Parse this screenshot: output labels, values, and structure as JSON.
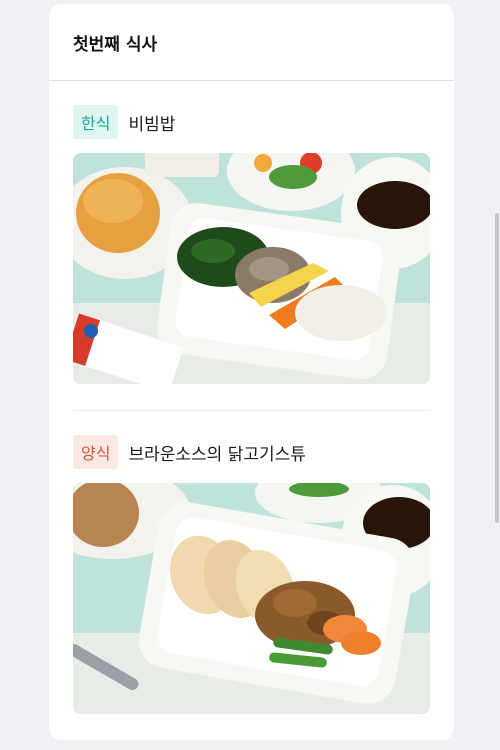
{
  "header": {
    "title": "첫번째 식사"
  },
  "meals": [
    {
      "badge": "한식",
      "name": "비빔밥",
      "photo_icon": "bibimbap-photo"
    },
    {
      "badge": "양식",
      "name": "브라운소스의 닭고기스튜",
      "photo_icon": "chicken-stew-photo"
    }
  ],
  "colors": {
    "korean_badge_bg": "#dff5f2",
    "korean_badge_text": "#1aa59a",
    "western_badge_bg": "#fde9e3",
    "western_badge_text": "#d2553a"
  }
}
